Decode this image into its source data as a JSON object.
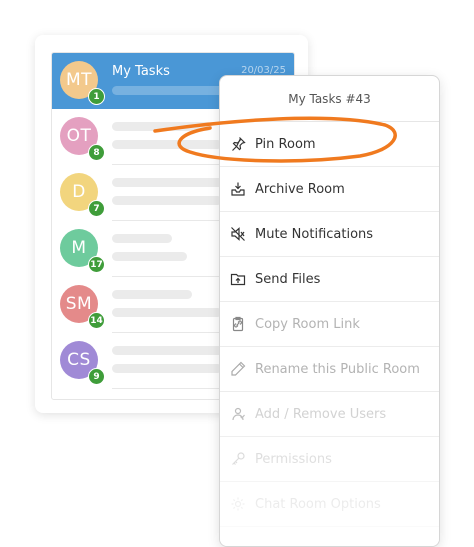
{
  "rooms": [
    {
      "initials": "MT",
      "name": "My Tasks",
      "date": "20/03/25",
      "unread": "1",
      "color": "#f3c98c",
      "selected": true
    },
    {
      "initials": "OT",
      "unread": "8",
      "color": "#e4a0c0"
    },
    {
      "initials": "D",
      "unread": "7",
      "color": "#f2d57e"
    },
    {
      "initials": "M",
      "unread": "17",
      "color": "#6ecb9d"
    },
    {
      "initials": "SM",
      "unread": "14",
      "color": "#e48a8a"
    },
    {
      "initials": "CS",
      "unread": "9",
      "color": "#a08ad6"
    }
  ],
  "context_menu": {
    "title": "My Tasks #43",
    "items": [
      {
        "label": "Pin Room",
        "icon": "pin-icon"
      },
      {
        "label": "Archive Room",
        "icon": "archive-icon"
      },
      {
        "label": "Mute Notifications",
        "icon": "mute-icon"
      },
      {
        "label": "Send Files",
        "icon": "folder-icon"
      },
      {
        "label": "Copy Room Link",
        "icon": "copy-link-icon"
      },
      {
        "label": "Rename this Public Room",
        "icon": "pencil-icon"
      },
      {
        "label": "Add / Remove Users",
        "icon": "users-icon"
      },
      {
        "label": "Permissions",
        "icon": "key-icon"
      },
      {
        "label": "Chat Room Options",
        "icon": "gear-icon"
      }
    ]
  },
  "colors": {
    "accent": "#4a97d6",
    "highlight": "#f07a1f",
    "badge": "#3f9d3a"
  }
}
